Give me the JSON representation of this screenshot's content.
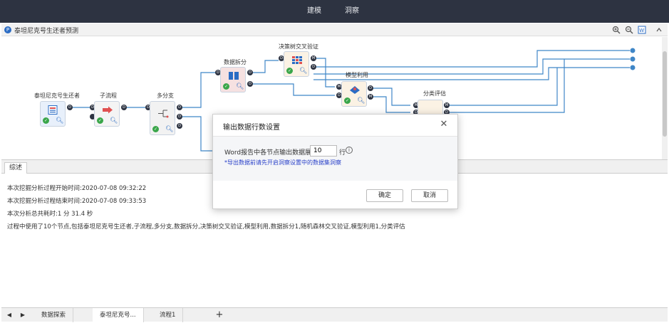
{
  "topbar": {
    "tabs": [
      {
        "label": "建模"
      },
      {
        "label": "洞察"
      }
    ]
  },
  "titlebar": {
    "title": "泰坦尼克号生还者预测",
    "logo_glyph": "P",
    "icons": [
      "zoom-in-icon",
      "zoom-out-icon",
      "word-export-icon",
      "collapse-icon"
    ]
  },
  "nodes": {
    "n1": {
      "label": "泰坦尼克号生还者"
    },
    "n2": {
      "label": "子流程"
    },
    "n3": {
      "label": "多分支"
    },
    "n4": {
      "label": "数据拆分"
    },
    "n5": {
      "label": "决策树交叉验证"
    },
    "n6": {
      "label": "模型利用"
    },
    "n7": {
      "label": "分类评估"
    }
  },
  "ports": {
    "d": "D",
    "m": "M"
  },
  "bottom": {
    "tab": "综述",
    "lines": [
      "本次挖掘分析过程开始时间:2020-07-08 09:32:22",
      "本次挖掘分析过程结束时间:2020-07-08 09:33:53",
      "本次分析总共耗时:1 分 31.4 秒",
      "过程中使用了10个节点,包括泰坦尼克号生还者,子流程,多分支,数据拆分,决策树交叉验证,模型利用,数据拆分1,随机森林交叉验证,模型利用1,分类评估"
    ]
  },
  "statusbar": {
    "tabs": [
      {
        "label": "数据探索"
      },
      {
        "label": "泰坦尼克号..."
      },
      {
        "label": "流程1"
      }
    ],
    "add_glyph": "+"
  },
  "dialog": {
    "title": "输出数据行数设置",
    "row_label": "Word报告中各节点输出数据展示",
    "rows_value": "10",
    "suffix": "行",
    "info_glyph": "i",
    "note": "*导出数据前请先开启洞察设置中的数据集洞察",
    "confirm_label": "确定",
    "cancel_label": "取消"
  },
  "colors": {
    "topbar": "#2d3341",
    "accent": "#2b6cc4",
    "link": "#2a41c9",
    "ok": "#3aa64a"
  }
}
